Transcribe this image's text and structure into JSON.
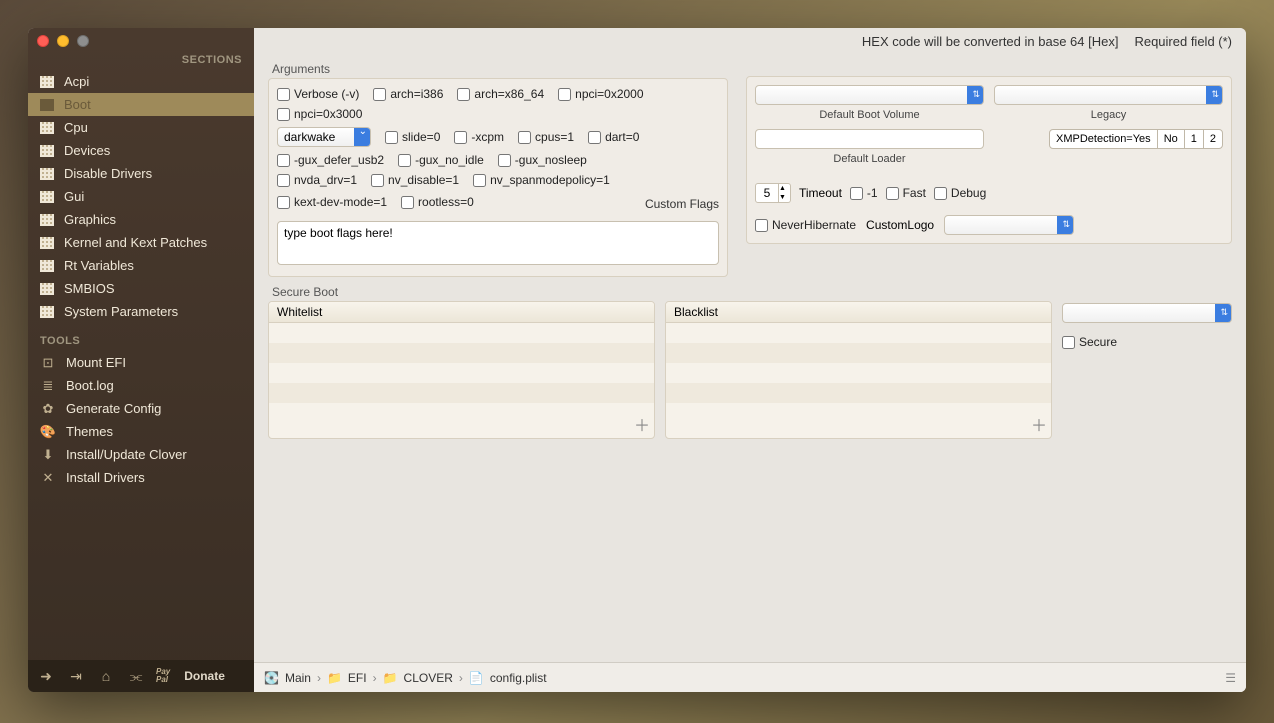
{
  "sidebar": {
    "sections_label": "SECTIONS",
    "tools_label": "TOOLS",
    "items": [
      {
        "label": "Acpi"
      },
      {
        "label": "Boot"
      },
      {
        "label": "Cpu"
      },
      {
        "label": "Devices"
      },
      {
        "label": "Disable Drivers"
      },
      {
        "label": "Gui"
      },
      {
        "label": "Graphics"
      },
      {
        "label": "Kernel and Kext Patches"
      },
      {
        "label": "Rt Variables"
      },
      {
        "label": "SMBIOS"
      },
      {
        "label": "System Parameters"
      }
    ],
    "tools": [
      {
        "label": "Mount EFI"
      },
      {
        "label": "Boot.log"
      },
      {
        "label": "Generate Config"
      },
      {
        "label": "Themes"
      },
      {
        "label": "Install/Update Clover"
      },
      {
        "label": "Install Drivers"
      }
    ],
    "donate": "Donate"
  },
  "top": {
    "hex_note": "HEX code will be converted in base 64 [Hex]",
    "required": "Required field (*)"
  },
  "arguments": {
    "title": "Arguments",
    "checks_row1": [
      "Verbose (-v)",
      "arch=i386",
      "arch=x86_64",
      "npci=0x2000",
      "npci=0x3000"
    ],
    "darkwake": "darkwake",
    "checks_row2": [
      "slide=0",
      "-xcpm",
      "cpus=1",
      "dart=0"
    ],
    "checks_row3": [
      "-gux_defer_usb2",
      "-gux_no_idle",
      "-gux_nosleep"
    ],
    "checks_row4": [
      "nvda_drv=1",
      "nv_disable=1",
      "nv_spanmodepolicy=1"
    ],
    "checks_row5": [
      "kext-dev-mode=1",
      "rootless=0"
    ],
    "custom_flags_label": "Custom Flags",
    "textarea_value": "type boot flags here!"
  },
  "boot_settings": {
    "default_volume_label": "Default Boot Volume",
    "legacy_label": "Legacy",
    "default_loader_label": "Default Loader",
    "xmp_label": "XMPDetection=Yes",
    "xmp_no": "No",
    "xmp_1": "1",
    "xmp_2": "2",
    "timeout_value": "5",
    "timeout_label": "Timeout",
    "minus1": "-1",
    "fast": "Fast",
    "debug": "Debug",
    "never_hibernate": "NeverHibernate",
    "custom_logo": "CustomLogo"
  },
  "secure_boot": {
    "title": "Secure Boot",
    "whitelist": "Whitelist",
    "blacklist": "Blacklist",
    "secure": "Secure"
  },
  "breadcrumb": {
    "main": "Main",
    "efi": "EFI",
    "clover": "CLOVER",
    "config": "config.plist"
  }
}
